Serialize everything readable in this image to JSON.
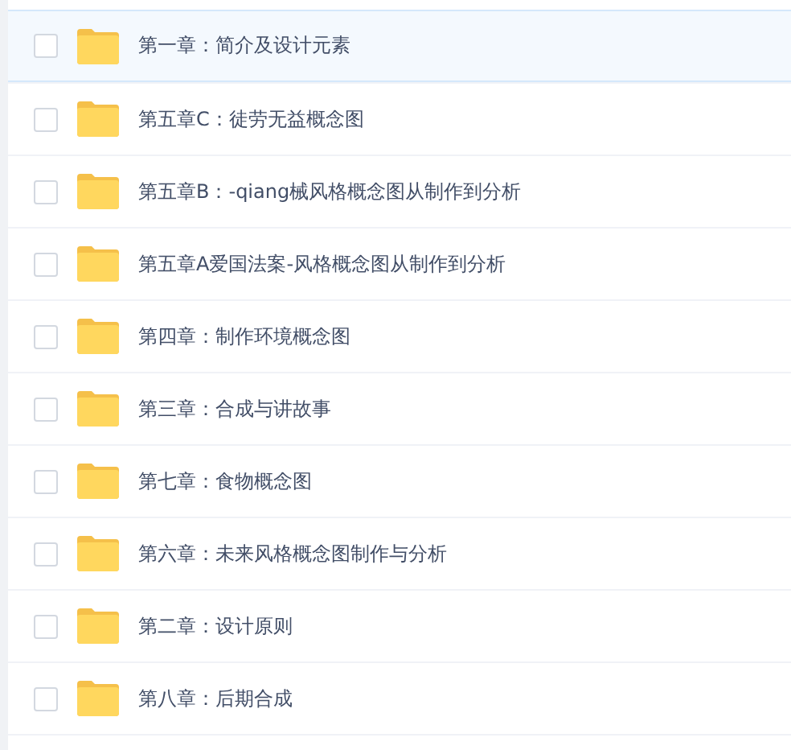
{
  "folders": [
    {
      "name": "第一章：简介及设计元素",
      "selected": true,
      "checked": false
    },
    {
      "name": "第五章C：徒劳无益概念图",
      "selected": false,
      "checked": false
    },
    {
      "name": "第五章B：-qiang械风格概念图从制作到分析",
      "selected": false,
      "checked": false
    },
    {
      "name": "第五章A爱国法案-风格概念图从制作到分析",
      "selected": false,
      "checked": false
    },
    {
      "name": "第四章：制作环境概念图",
      "selected": false,
      "checked": false
    },
    {
      "name": "第三章：合成与讲故事",
      "selected": false,
      "checked": false
    },
    {
      "name": "第七章：食物概念图",
      "selected": false,
      "checked": false
    },
    {
      "name": "第六章：未来风格概念图制作与分析",
      "selected": false,
      "checked": false
    },
    {
      "name": "第二章：设计原则",
      "selected": false,
      "checked": false
    },
    {
      "name": "第八章：后期合成",
      "selected": false,
      "checked": false
    }
  ]
}
